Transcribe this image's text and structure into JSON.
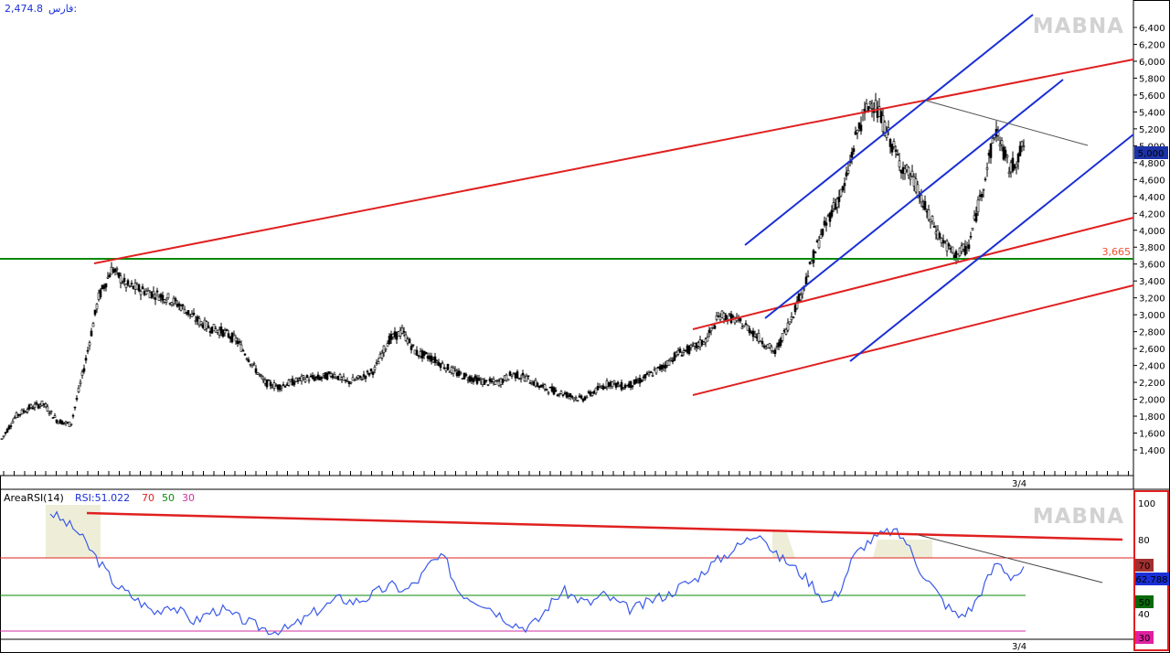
{
  "header": {
    "symbol_value": "2,474.8",
    "symbol_label": "فارس:"
  },
  "watermark": "MABNA",
  "date_label": "3/4",
  "colors": {
    "up_trend": "#e02020",
    "channel": "#1a2fd6",
    "support": "#0a8a0a",
    "rsi": "#3a5ae8",
    "grey_trend": "#555555"
  },
  "chart_data": [
    {
      "type": "line",
      "title": "",
      "ylim": [
        1250,
        6600
      ],
      "y_ticks": [
        "1,400",
        "1,600",
        "1,800",
        "2,000",
        "2,200",
        "2,400",
        "2,600",
        "2,800",
        "3,000",
        "3,200",
        "3,400",
        "3,600",
        "3,800",
        "4,000",
        "4,200",
        "4,400",
        "4,600",
        "4,800",
        "5,000",
        "5,200",
        "5,400",
        "5,600",
        "5,800",
        "6,000",
        "6,200",
        "6,400"
      ],
      "current_price": "5,000",
      "support_level": "3,665",
      "x_ticks": [
        "3/4"
      ],
      "price_series": [
        1530,
        1800,
        1900,
        1950,
        1750,
        1700,
        2400,
        3200,
        3550,
        3350,
        3300,
        3250,
        3200,
        3100,
        2950,
        2850,
        2800,
        2700,
        2450,
        2200,
        2150,
        2200,
        2250,
        2250,
        2300,
        2200,
        2250,
        2350,
        2700,
        2800,
        2550,
        2500,
        2400,
        2300,
        2250,
        2200,
        2200,
        2300,
        2250,
        2150,
        2100,
        2050,
        2000,
        2100,
        2200,
        2150,
        2200,
        2300,
        2400,
        2550,
        2600,
        2700,
        3000,
        2950,
        2850,
        2700,
        2550,
        2900,
        3300,
        3800,
        4200,
        4500,
        5200,
        5550,
        5200,
        4800,
        4600,
        4200,
        3900,
        3700,
        3800,
        4500,
        5200,
        4700,
        5000
      ]
    },
    {
      "type": "line",
      "title": "AreaRSI(14)",
      "legend": [
        "RSI:51.022",
        "70",
        "50",
        "30"
      ],
      "ylim": [
        28,
        100
      ],
      "y_ticks": [
        "100",
        "80",
        "40"
      ],
      "levels": [
        "70",
        "50",
        "30"
      ],
      "current_value": "62.788",
      "x_ticks": [
        "3/4"
      ],
      "rsi_series": [
        95,
        90,
        85,
        75,
        65,
        55,
        50,
        45,
        40,
        45,
        40,
        35,
        40,
        42,
        38,
        35,
        32,
        30,
        31,
        35,
        40,
        44,
        48,
        46,
        48,
        52,
        55,
        52,
        58,
        68,
        70,
        52,
        48,
        45,
        40,
        35,
        32,
        35,
        45,
        52,
        48,
        45,
        50,
        46,
        42,
        44,
        48,
        50,
        55,
        58,
        65,
        70,
        75,
        80,
        85,
        72,
        68,
        62,
        55,
        45,
        52,
        70,
        78,
        82,
        85,
        80,
        65,
        55,
        45,
        38,
        42,
        55,
        68,
        60,
        63
      ]
    }
  ]
}
